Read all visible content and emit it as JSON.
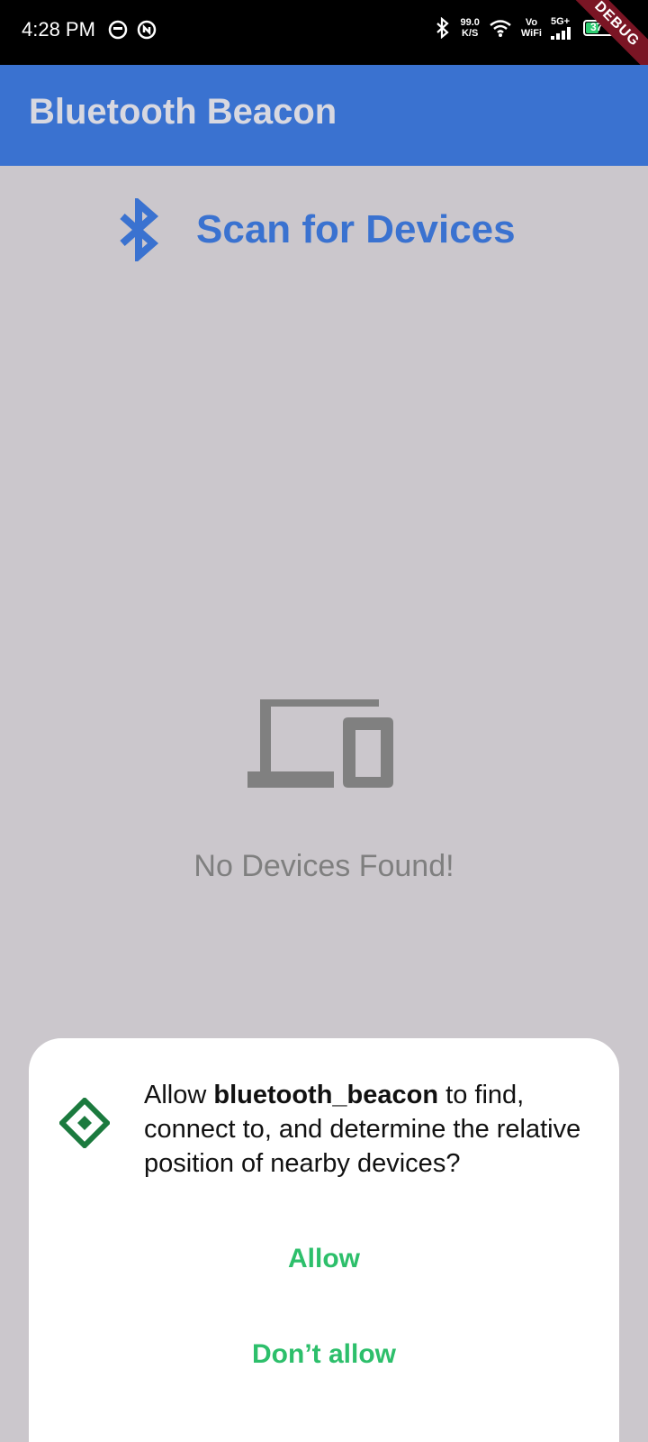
{
  "status_bar": {
    "time": "4:28 PM",
    "net_speed_value": "99.0",
    "net_speed_unit": "K/S",
    "vowifi_top": "Vo",
    "vowifi_bottom": "WiFi",
    "network_type": "5G+",
    "battery_level": "37",
    "battery_color": "#2ecc71"
  },
  "debug_banner": "DEBUG",
  "app_bar": {
    "title": "Bluetooth Beacon",
    "color": "#3a72d0"
  },
  "scan": {
    "icon": "bluetooth-icon",
    "label": "Scan for Devices"
  },
  "empty_state": {
    "icon": "devices-icon",
    "message": "No Devices Found!"
  },
  "permission_dialog": {
    "icon": "nearby-devices-icon",
    "text_prefix": "Allow ",
    "app_name": "bluetooth_beacon",
    "text_suffix": " to find, connect to, and determine the relative position of nearby devices?",
    "allow_label": "Allow",
    "deny_label": "Don’t allow",
    "button_color": "#2dbf6b"
  }
}
